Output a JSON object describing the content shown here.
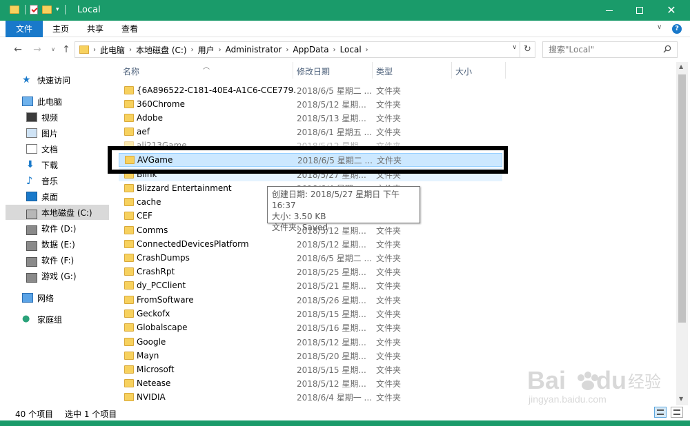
{
  "window": {
    "title": "Local",
    "qa_arrow": "▾"
  },
  "ribbon": {
    "tabs": [
      "文件",
      "主页",
      "共享",
      "查看"
    ],
    "help": "?"
  },
  "address": {
    "breadcrumbs": [
      "此电脑",
      "本地磁盘 (C:)",
      "用户",
      "Administrator",
      "AppData",
      "Local"
    ],
    "search_placeholder": "搜索\"Local\""
  },
  "sidebar": {
    "items": [
      {
        "label": "快速访问",
        "icon": "star-icon",
        "level": "top"
      },
      {
        "label": "此电脑",
        "icon": "computer-icon",
        "level": "top"
      },
      {
        "label": "视频",
        "icon": "video-icon",
        "level": "sub"
      },
      {
        "label": "图片",
        "icon": "picture-icon",
        "level": "sub"
      },
      {
        "label": "文档",
        "icon": "document-icon",
        "level": "sub"
      },
      {
        "label": "下载",
        "icon": "download-icon",
        "level": "sub"
      },
      {
        "label": "音乐",
        "icon": "music-icon",
        "level": "sub"
      },
      {
        "label": "桌面",
        "icon": "desktop-icon",
        "level": "sub"
      },
      {
        "label": "本地磁盘 (C:)",
        "icon": "drive-icon",
        "level": "sub",
        "selected": true
      },
      {
        "label": "软件 (D:)",
        "icon": "drive-icon",
        "level": "sub"
      },
      {
        "label": "数据 (E:)",
        "icon": "drive-icon",
        "level": "sub"
      },
      {
        "label": "软件 (F:)",
        "icon": "drive-icon",
        "level": "sub"
      },
      {
        "label": "游戏 (G:)",
        "icon": "drive-icon",
        "level": "sub"
      },
      {
        "label": "网络",
        "icon": "network-icon",
        "level": "top"
      },
      {
        "label": "家庭组",
        "icon": "homegroup-icon",
        "level": "top"
      }
    ]
  },
  "columns": {
    "name": "名称",
    "date": "修改日期",
    "type": "类型",
    "size": "大小"
  },
  "files": [
    {
      "name": "{6A896522-C181-40E4-A1C6-CCE779...",
      "date": "2018/6/5 星期二 ...",
      "type": "文件夹"
    },
    {
      "name": "360Chrome",
      "date": "2018/5/12 星期...",
      "type": "文件夹"
    },
    {
      "name": "Adobe",
      "date": "2018/5/13 星期...",
      "type": "文件夹"
    },
    {
      "name": "aef",
      "date": "2018/6/1 星期五 ...",
      "type": "文件夹"
    },
    {
      "name": "ali213Game...",
      "date": "2018/5/12 星期...",
      "type": "文件夹"
    },
    {
      "name": "AVGame",
      "date": "2018/6/5 星期二 ...",
      "type": "文件夹",
      "selected": true
    },
    {
      "name": "Blink",
      "date": "2018/5/27 星期...",
      "type": "文件夹"
    },
    {
      "name": "Blizzard Entertainment",
      "date": "2018/6/4 星期...",
      "type": "文件夹"
    },
    {
      "name": "cache",
      "date": "",
      "type": "文件夹"
    },
    {
      "name": "CEF",
      "date": "",
      "type": "文件夹"
    },
    {
      "name": "Comms",
      "date": "2018/5/12 星期...",
      "type": "文件夹"
    },
    {
      "name": "ConnectedDevicesPlatform",
      "date": "2018/5/12 星期...",
      "type": "文件夹"
    },
    {
      "name": "CrashDumps",
      "date": "2018/6/5 星期二 ...",
      "type": "文件夹"
    },
    {
      "name": "CrashRpt",
      "date": "2018/5/25 星期...",
      "type": "文件夹"
    },
    {
      "name": "dy_PCClient",
      "date": "2018/5/21 星期...",
      "type": "文件夹"
    },
    {
      "name": "FromSoftware",
      "date": "2018/5/26 星期...",
      "type": "文件夹"
    },
    {
      "name": "Geckofx",
      "date": "2018/5/15 星期...",
      "type": "文件夹"
    },
    {
      "name": "Globalscape",
      "date": "2018/5/16 星期...",
      "type": "文件夹"
    },
    {
      "name": "Google",
      "date": "2018/5/12 星期...",
      "type": "文件夹"
    },
    {
      "name": "Mayn",
      "date": "2018/5/20 星期...",
      "type": "文件夹"
    },
    {
      "name": "Microsoft",
      "date": "2018/5/15 星期...",
      "type": "文件夹"
    },
    {
      "name": "Netease",
      "date": "2018/5/12 星期...",
      "type": "文件夹"
    },
    {
      "name": "NVIDIA",
      "date": "2018/6/4 星期一 ...",
      "type": "文件夹"
    }
  ],
  "tooltip": {
    "created": "创建日期: 2018/5/27 星期日 下午 16:37",
    "size": "大小: 3.50 KB",
    "folder": "文件夹: Saved"
  },
  "status": {
    "count": "40 个项目",
    "selected": "选中 1 个项目"
  },
  "watermark": {
    "brand": "Bai",
    "brand2": "du",
    "cn": "经验",
    "url": "jingyan.baidu.com"
  },
  "colors": {
    "titlebar": "#1a9b6a",
    "file_tab": "#1979ca",
    "selection": "#cce8ff",
    "folder": "#f7d15e"
  }
}
